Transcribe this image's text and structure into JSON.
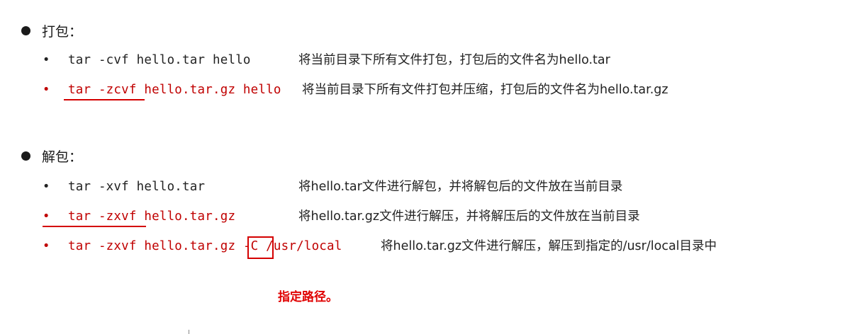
{
  "sections": [
    {
      "title": "打包：",
      "items": [
        {
          "bullet": "•",
          "cmd": "tar -cvf hello.tar hello",
          "desc": "将当前目录下所有文件打包，打包后的文件名为hello.tar"
        },
        {
          "bullet": "•",
          "cmd": "tar -zcvf hello.tar.gz hello",
          "desc": "将当前目录下所有文件打包并压缩，打包后的文件名为hello.tar.gz"
        }
      ]
    },
    {
      "title": "解包：",
      "items": [
        {
          "bullet": "•",
          "cmd": "tar -xvf hello.tar",
          "desc": "将hello.tar文件进行解包，并将解包后的文件放在当前目录"
        },
        {
          "bullet": "•",
          "cmd": "tar -zxvf hello.tar.gz",
          "desc": "将hello.tar.gz文件进行解压，并将解压后的文件放在当前目录"
        },
        {
          "bullet": "•",
          "cmd_prefix": "tar -zxvf hello.tar.gz ",
          "cmd_option": "-C",
          "cmd_suffix": " /usr/local",
          "desc": "将hello.tar.gz文件进行解压，解压到指定的/usr/local目录中"
        }
      ]
    }
  ],
  "annotation": "指定路径。",
  "colors": {
    "command_red": "#c00000",
    "annotation_red": "#e00000",
    "text": "#222222"
  }
}
